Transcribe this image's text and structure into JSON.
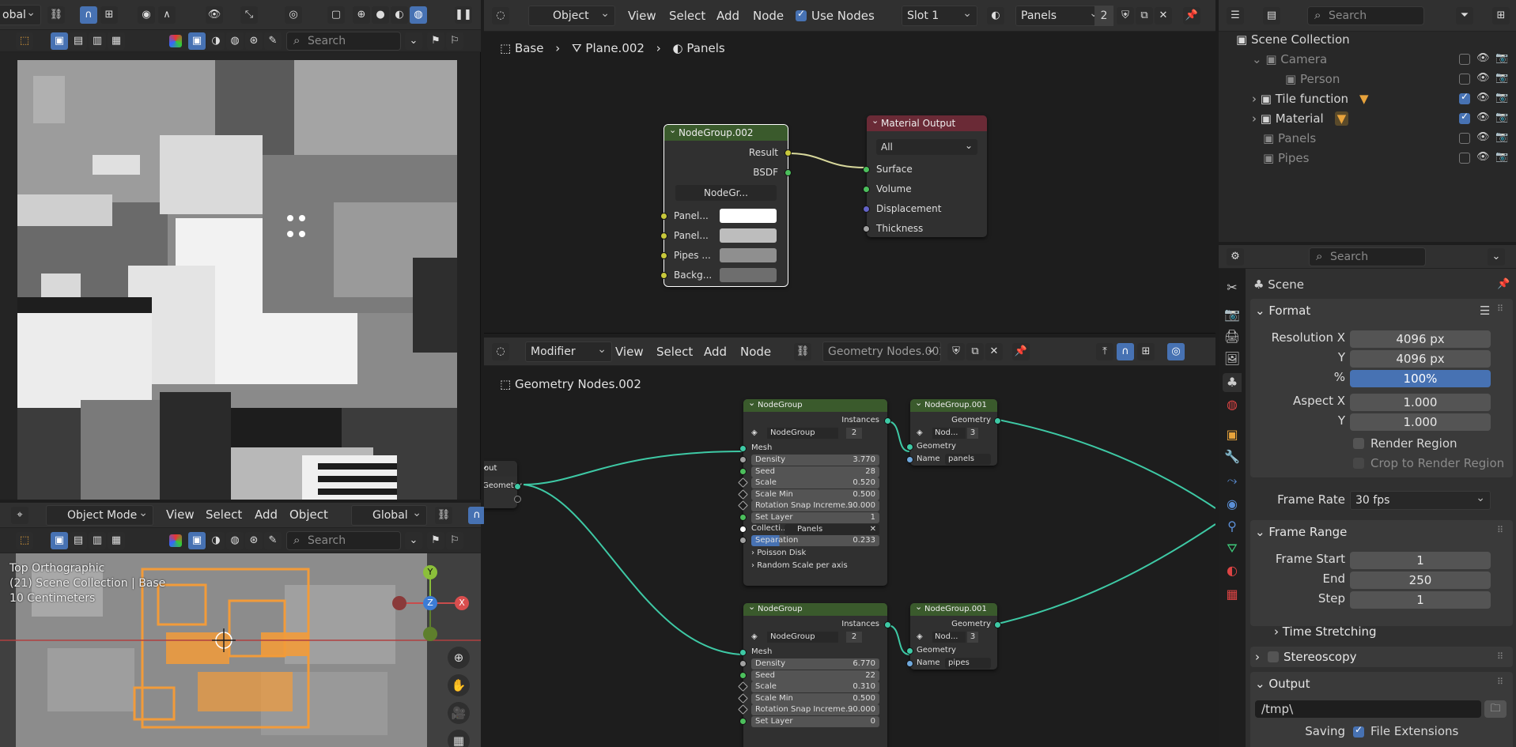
{
  "top_left_header": {
    "transform_label": "obal"
  },
  "image_editor": {
    "search_placeholder": "Search"
  },
  "viewport": {
    "mode": "Object Mode",
    "menus": [
      "View",
      "Select",
      "Add",
      "Object"
    ],
    "orientation": "Global",
    "search_placeholder": "Search",
    "overlay_lines": [
      "Top Orthographic",
      "(21) Scene Collection | Base",
      "10 Centimeters"
    ],
    "gizmo": {
      "y": "Y",
      "z": "Z",
      "x": "X"
    }
  },
  "shader_editor": {
    "editor_type": "Object",
    "menus": [
      "View",
      "Select",
      "Add",
      "Node"
    ],
    "use_nodes_label": "Use Nodes",
    "slot": "Slot 1",
    "material_name": "Panels",
    "user_count": "2",
    "breadcrumb": [
      "Base",
      "Plane.002",
      "Panels"
    ],
    "nodegroup": {
      "title": "NodeGroup.002",
      "outputs": [
        "Result",
        "BSDF"
      ],
      "selector": "NodeGr...",
      "inputs": [
        "Panel...",
        "Panel...",
        "Pipes ...",
        "Backg..."
      ],
      "input_colors": [
        "#ffffff",
        "#bdbdbd",
        "#8f8f8f",
        "#6e6e6e"
      ]
    },
    "material_output": {
      "title": "Material Output",
      "target": "All",
      "inputs": [
        "Surface",
        "Volume",
        "Displacement",
        "Thickness"
      ]
    }
  },
  "geometry_editor": {
    "editor_type": "Modifier",
    "menus": [
      "View",
      "Select",
      "Add",
      "Node"
    ],
    "tree_name": "Geometry Nodes.002",
    "breadcrumb": "Geometry Nodes.002",
    "group_input": {
      "title": "out",
      "output": "Geometry"
    },
    "nodegroup_a": {
      "title": "NodeGroup",
      "output": "Instances",
      "selector": "NodeGroup",
      "users": "2",
      "mesh_label": "Mesh",
      "fields": [
        {
          "label": "Density",
          "value": "3.770"
        },
        {
          "label": "Seed",
          "value": "28"
        },
        {
          "label": "Scale",
          "value": "0.520"
        },
        {
          "label": "Scale Min",
          "value": "0.500"
        },
        {
          "label": "Rotation Snap Increme...",
          "value": "90.000"
        },
        {
          "label": "Set Layer",
          "value": "1"
        }
      ],
      "collection_label": "Collecti...",
      "collection_value": "Panels",
      "separation_label": "Separation",
      "separation_value": "0.233",
      "subpanels": [
        "Poisson Disk",
        "Random Scale per axis"
      ]
    },
    "nodegroup_b": {
      "title": "NodeGroup",
      "output": "Instances",
      "selector": "NodeGroup",
      "users": "2",
      "mesh_label": "Mesh",
      "fields": [
        {
          "label": "Density",
          "value": "6.770"
        },
        {
          "label": "Seed",
          "value": "22"
        },
        {
          "label": "Scale",
          "value": "0.310"
        },
        {
          "label": "Scale Min",
          "value": "0.500"
        },
        {
          "label": "Rotation Snap Increme...",
          "value": "90.000"
        },
        {
          "label": "Set Layer",
          "value": "0"
        }
      ]
    },
    "nodegroup_c": {
      "title": "NodeGroup.001",
      "output": "Geometry",
      "selector": "Nod...",
      "users": "3",
      "input": "Geometry",
      "name_label": "Name",
      "name_value": "panels"
    },
    "nodegroup_d": {
      "title": "NodeGroup.001",
      "output": "Geometry",
      "selector": "Nod...",
      "users": "3",
      "input": "Geometry",
      "name_label": "Name",
      "name_value": "pipes"
    }
  },
  "outliner": {
    "search_placeholder": "Search",
    "rows": [
      {
        "label": "Scene Collection",
        "dim": false
      },
      {
        "label": "Camera",
        "dim": true
      },
      {
        "label": "Person",
        "dim": true
      },
      {
        "label": "Tile function",
        "dim": false
      },
      {
        "label": "Material",
        "dim": false
      },
      {
        "label": "Panels",
        "dim": true
      },
      {
        "label": "Pipes",
        "dim": true
      }
    ]
  },
  "properties": {
    "search_placeholder": "Search",
    "context": "Scene",
    "format_title": "Format",
    "resolution_x_label": "Resolution X",
    "resolution_x": "4096 px",
    "y_label": "Y",
    "resolution_y": "4096 px",
    "percent_label": "%",
    "percent": "100%",
    "aspect_x_label": "Aspect X",
    "aspect_x": "1.000",
    "aspect_y_label": "Y",
    "aspect_y": "1.000",
    "render_region": "Render Region",
    "crop_region": "Crop to Render Region",
    "frame_rate_label": "Frame Rate",
    "frame_rate": "30 fps",
    "frame_range_title": "Frame Range",
    "frame_start_label": "Frame Start",
    "frame_start": "1",
    "end_label": "End",
    "frame_end": "250",
    "step_label": "Step",
    "frame_step": "1",
    "time_stretching": "Time Stretching",
    "stereoscopy": "Stereoscopy",
    "output_title": "Output",
    "output_path": "/tmp\\",
    "saving_label": "Saving",
    "file_extensions": "File Extensions"
  }
}
